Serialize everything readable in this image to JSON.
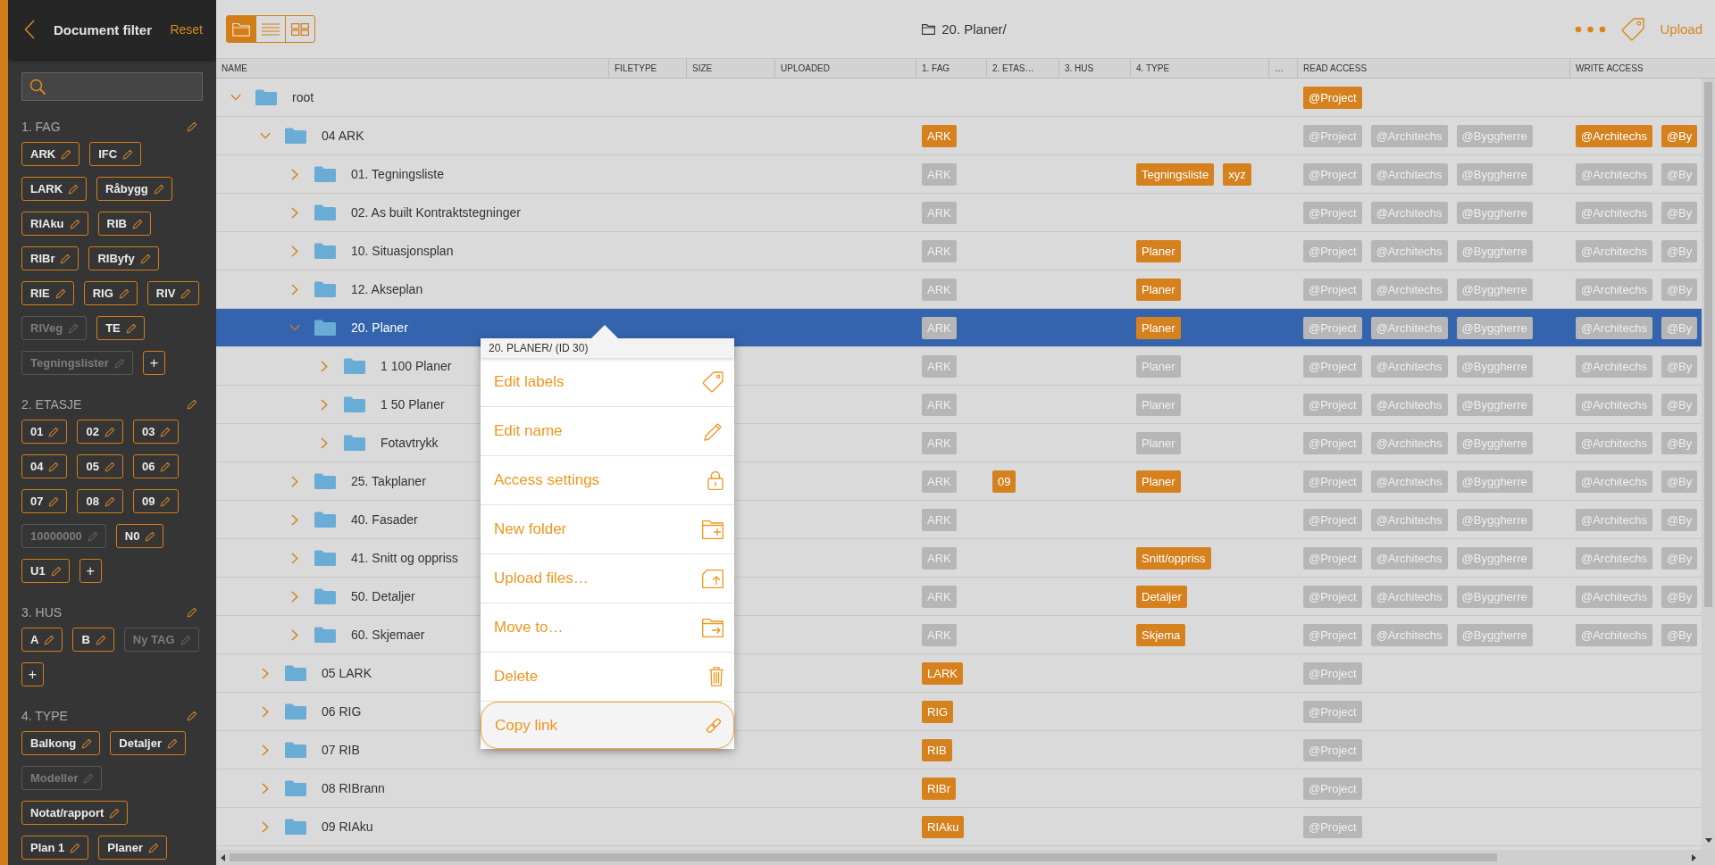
{
  "sidebar": {
    "title": "Document filter",
    "reset": "Reset",
    "sections": [
      {
        "title": "1. FAG",
        "tags": [
          {
            "label": "ARK",
            "disabled": false
          },
          {
            "label": "IFC",
            "disabled": false
          },
          {
            "label": "LARK",
            "disabled": false
          },
          {
            "label": "Råbygg",
            "disabled": false
          },
          {
            "label": "RIAku",
            "disabled": false
          },
          {
            "label": "RIB",
            "disabled": false
          },
          {
            "label": "RIBr",
            "disabled": false
          },
          {
            "label": "RIByfy",
            "disabled": false
          },
          {
            "label": "RIE",
            "disabled": false
          },
          {
            "label": "RIG",
            "disabled": false
          },
          {
            "label": "RIV",
            "disabled": false
          },
          {
            "label": "RIVeg",
            "disabled": true
          },
          {
            "label": "TE",
            "disabled": false
          },
          {
            "label": "Tegningslister",
            "disabled": true
          }
        ],
        "add": "+"
      },
      {
        "title": "2. ETASJE",
        "tags": [
          {
            "label": "01",
            "disabled": false
          },
          {
            "label": "02",
            "disabled": false
          },
          {
            "label": "03",
            "disabled": false
          },
          {
            "label": "04",
            "disabled": false
          },
          {
            "label": "05",
            "disabled": false
          },
          {
            "label": "06",
            "disabled": false
          },
          {
            "label": "07",
            "disabled": false
          },
          {
            "label": "08",
            "disabled": false
          },
          {
            "label": "09",
            "disabled": false
          },
          {
            "label": "10000000",
            "disabled": true
          },
          {
            "label": "N0",
            "disabled": false
          },
          {
            "label": "U1",
            "disabled": false
          }
        ],
        "add": "+"
      },
      {
        "title": "3. HUS",
        "tags": [
          {
            "label": "A",
            "disabled": false
          },
          {
            "label": "B",
            "disabled": false
          },
          {
            "label": "Ny TAG",
            "disabled": true
          }
        ],
        "add": "+"
      },
      {
        "title": "4. TYPE",
        "tags": [
          {
            "label": "Balkong",
            "disabled": false
          },
          {
            "label": "Detaljer",
            "disabled": false
          },
          {
            "label": "Modeller",
            "disabled": true
          },
          {
            "label": "Notat/rapport",
            "disabled": false
          },
          {
            "label": "Plan 1",
            "disabled": false
          },
          {
            "label": "Planer",
            "disabled": false
          }
        ]
      }
    ]
  },
  "toolbar": {
    "views": [
      {
        "kind": "folders",
        "selected": true
      },
      {
        "kind": "list",
        "selected": false
      },
      {
        "kind": "grid",
        "selected": false
      }
    ],
    "path": "20. Planer/",
    "upload": "Upload"
  },
  "table": {
    "columns": [
      "NAME",
      "FILETYPE",
      "SIZE",
      "UPLOADED",
      "1. FAG",
      "2. ETAS…",
      "3. HUS",
      "4. TYPE",
      "…",
      "READ ACCESS",
      "WRITE ACCESS"
    ],
    "rows": [
      {
        "name": "root",
        "expanded": true,
        "selected": false,
        "read_access": [
          {
            "label": "@Project",
            "inherited": false
          }
        ],
        "children": [
          {
            "name": "04 ARK",
            "expanded": true,
            "selected": false,
            "fag": [
              {
                "label": "ARK",
                "inherited": false
              }
            ],
            "read_access": [
              {
                "label": "@Project",
                "inherited": true
              },
              {
                "label": "@Architechs",
                "inherited": true
              },
              {
                "label": "@Byggherre",
                "inherited": true
              }
            ],
            "write_access": [
              {
                "label": "@Architechs",
                "inherited": false
              },
              {
                "label": "@By",
                "inherited": false
              }
            ],
            "children": [
              {
                "name": "01. Tegningsliste",
                "expanded": false,
                "selected": false,
                "fag": [
                  {
                    "label": "ARK",
                    "inherited": true
                  }
                ],
                "type": [
                  {
                    "label": "Tegningsliste",
                    "inherited": false
                  },
                  {
                    "label": "xyz",
                    "inherited": false
                  }
                ],
                "read_access": [
                  {
                    "label": "@Project",
                    "inherited": true
                  },
                  {
                    "label": "@Architechs",
                    "inherited": true
                  },
                  {
                    "label": "@Byggherre",
                    "inherited": true
                  }
                ],
                "write_access": [
                  {
                    "label": "@Architechs",
                    "inherited": true
                  },
                  {
                    "label": "@By",
                    "inherited": true
                  }
                ]
              },
              {
                "name": "02. As built Kontraktstegninger",
                "expanded": false,
                "selected": false,
                "fag": [
                  {
                    "label": "ARK",
                    "inherited": true
                  }
                ],
                "read_access": [
                  {
                    "label": "@Project",
                    "inherited": true
                  },
                  {
                    "label": "@Architechs",
                    "inherited": true
                  },
                  {
                    "label": "@Byggherre",
                    "inherited": true
                  }
                ],
                "write_access": [
                  {
                    "label": "@Architechs",
                    "inherited": true
                  },
                  {
                    "label": "@By",
                    "inherited": true
                  }
                ]
              },
              {
                "name": "10. Situasjonsplan",
                "expanded": false,
                "selected": false,
                "fag": [
                  {
                    "label": "ARK",
                    "inherited": true
                  }
                ],
                "type": [
                  {
                    "label": "Planer",
                    "inherited": false
                  }
                ],
                "read_access": [
                  {
                    "label": "@Project",
                    "inherited": true
                  },
                  {
                    "label": "@Architechs",
                    "inherited": true
                  },
                  {
                    "label": "@Byggherre",
                    "inherited": true
                  }
                ],
                "write_access": [
                  {
                    "label": "@Architechs",
                    "inherited": true
                  },
                  {
                    "label": "@By",
                    "inherited": true
                  }
                ]
              },
              {
                "name": "12. Akseplan",
                "expanded": false,
                "selected": false,
                "fag": [
                  {
                    "label": "ARK",
                    "inherited": true
                  }
                ],
                "type": [
                  {
                    "label": "Planer",
                    "inherited": false
                  }
                ],
                "read_access": [
                  {
                    "label": "@Project",
                    "inherited": true
                  },
                  {
                    "label": "@Architechs",
                    "inherited": true
                  },
                  {
                    "label": "@Byggherre",
                    "inherited": true
                  }
                ],
                "write_access": [
                  {
                    "label": "@Architechs",
                    "inherited": true
                  },
                  {
                    "label": "@By",
                    "inherited": true
                  }
                ]
              },
              {
                "name": "20. Planer",
                "expanded": true,
                "selected": true,
                "fag": [
                  {
                    "label": "ARK",
                    "inherited": true
                  }
                ],
                "type": [
                  {
                    "label": "Planer",
                    "inherited": false
                  }
                ],
                "read_access": [
                  {
                    "label": "@Project",
                    "inherited": true
                  },
                  {
                    "label": "@Architechs",
                    "inherited": true
                  },
                  {
                    "label": "@Byggherre",
                    "inherited": true
                  }
                ],
                "write_access": [
                  {
                    "label": "@Architechs",
                    "inherited": true
                  },
                  {
                    "label": "@By",
                    "inherited": true
                  }
                ],
                "children": [
                  {
                    "name": "1 100 Planer",
                    "expanded": false,
                    "selected": false,
                    "fag": [
                      {
                        "label": "ARK",
                        "inherited": true
                      }
                    ],
                    "type": [
                      {
                        "label": "Planer",
                        "inherited": true
                      }
                    ],
                    "read_access": [
                      {
                        "label": "@Project",
                        "inherited": true
                      },
                      {
                        "label": "@Architechs",
                        "inherited": true
                      },
                      {
                        "label": "@Byggherre",
                        "inherited": true
                      }
                    ],
                    "write_access": [
                      {
                        "label": "@Architechs",
                        "inherited": true
                      },
                      {
                        "label": "@By",
                        "inherited": true
                      }
                    ]
                  },
                  {
                    "name": "1 50 Planer",
                    "expanded": false,
                    "selected": false,
                    "fag": [
                      {
                        "label": "ARK",
                        "inherited": true
                      }
                    ],
                    "type": [
                      {
                        "label": "Planer",
                        "inherited": true
                      }
                    ],
                    "read_access": [
                      {
                        "label": "@Project",
                        "inherited": true
                      },
                      {
                        "label": "@Architechs",
                        "inherited": true
                      },
                      {
                        "label": "@Byggherre",
                        "inherited": true
                      }
                    ],
                    "write_access": [
                      {
                        "label": "@Architechs",
                        "inherited": true
                      },
                      {
                        "label": "@By",
                        "inherited": true
                      }
                    ]
                  },
                  {
                    "name": "Fotavtrykk",
                    "expanded": false,
                    "selected": false,
                    "fag": [
                      {
                        "label": "ARK",
                        "inherited": true
                      }
                    ],
                    "type": [
                      {
                        "label": "Planer",
                        "inherited": true
                      }
                    ],
                    "read_access": [
                      {
                        "label": "@Project",
                        "inherited": true
                      },
                      {
                        "label": "@Architechs",
                        "inherited": true
                      },
                      {
                        "label": "@Byggherre",
                        "inherited": true
                      }
                    ],
                    "write_access": [
                      {
                        "label": "@Architechs",
                        "inherited": true
                      },
                      {
                        "label": "@By",
                        "inherited": true
                      }
                    ]
                  }
                ]
              },
              {
                "name": "25. Takplaner",
                "expanded": false,
                "selected": false,
                "fag": [
                  {
                    "label": "ARK",
                    "inherited": true
                  }
                ],
                "etasje": [
                  {
                    "label": "09",
                    "inherited": false
                  }
                ],
                "type": [
                  {
                    "label": "Planer",
                    "inherited": false
                  }
                ],
                "read_access": [
                  {
                    "label": "@Project",
                    "inherited": true
                  },
                  {
                    "label": "@Architechs",
                    "inherited": true
                  },
                  {
                    "label": "@Byggherre",
                    "inherited": true
                  }
                ],
                "write_access": [
                  {
                    "label": "@Architechs",
                    "inherited": true
                  },
                  {
                    "label": "@By",
                    "inherited": true
                  }
                ]
              },
              {
                "name": "40. Fasader",
                "expanded": false,
                "selected": false,
                "fag": [
                  {
                    "label": "ARK",
                    "inherited": true
                  }
                ],
                "read_access": [
                  {
                    "label": "@Project",
                    "inherited": true
                  },
                  {
                    "label": "@Architechs",
                    "inherited": true
                  },
                  {
                    "label": "@Byggherre",
                    "inherited": true
                  }
                ],
                "write_access": [
                  {
                    "label": "@Architechs",
                    "inherited": true
                  },
                  {
                    "label": "@By",
                    "inherited": true
                  }
                ]
              },
              {
                "name": "41. Snitt og oppriss",
                "expanded": false,
                "selected": false,
                "fag": [
                  {
                    "label": "ARK",
                    "inherited": true
                  }
                ],
                "type": [
                  {
                    "label": "Snitt/oppriss",
                    "inherited": false
                  }
                ],
                "read_access": [
                  {
                    "label": "@Project",
                    "inherited": true
                  },
                  {
                    "label": "@Architechs",
                    "inherited": true
                  },
                  {
                    "label": "@Byggherre",
                    "inherited": true
                  }
                ],
                "write_access": [
                  {
                    "label": "@Architechs",
                    "inherited": true
                  },
                  {
                    "label": "@By",
                    "inherited": true
                  }
                ]
              },
              {
                "name": "50. Detaljer",
                "expanded": false,
                "selected": false,
                "fag": [
                  {
                    "label": "ARK",
                    "inherited": true
                  }
                ],
                "type": [
                  {
                    "label": "Detaljer",
                    "inherited": false
                  }
                ],
                "read_access": [
                  {
                    "label": "@Project",
                    "inherited": true
                  },
                  {
                    "label": "@Architechs",
                    "inherited": true
                  },
                  {
                    "label": "@Byggherre",
                    "inherited": true
                  }
                ],
                "write_access": [
                  {
                    "label": "@Architechs",
                    "inherited": true
                  },
                  {
                    "label": "@By",
                    "inherited": true
                  }
                ]
              },
              {
                "name": "60. Skjemaer",
                "expanded": false,
                "selected": false,
                "fag": [
                  {
                    "label": "ARK",
                    "inherited": true
                  }
                ],
                "type": [
                  {
                    "label": "Skjema",
                    "inherited": false
                  }
                ],
                "read_access": [
                  {
                    "label": "@Project",
                    "inherited": true
                  },
                  {
                    "label": "@Architechs",
                    "inherited": true
                  },
                  {
                    "label": "@Byggherre",
                    "inherited": true
                  }
                ],
                "write_access": [
                  {
                    "label": "@Architechs",
                    "inherited": true
                  },
                  {
                    "label": "@By",
                    "inherited": true
                  }
                ]
              }
            ]
          },
          {
            "name": "05 LARK",
            "expanded": false,
            "selected": false,
            "fag": [
              {
                "label": "LARK",
                "inherited": false
              }
            ],
            "read_access": [
              {
                "label": "@Project",
                "inherited": true
              }
            ]
          },
          {
            "name": "06 RIG",
            "expanded": false,
            "selected": false,
            "fag": [
              {
                "label": "RIG",
                "inherited": false
              }
            ],
            "read_access": [
              {
                "label": "@Project",
                "inherited": true
              }
            ]
          },
          {
            "name": "07 RIB",
            "expanded": false,
            "selected": false,
            "fag": [
              {
                "label": "RIB",
                "inherited": false
              }
            ],
            "read_access": [
              {
                "label": "@Project",
                "inherited": true
              }
            ]
          },
          {
            "name": "08 RIBrann",
            "expanded": false,
            "selected": false,
            "fag": [
              {
                "label": "RIBr",
                "inherited": false
              }
            ],
            "read_access": [
              {
                "label": "@Project",
                "inherited": true
              }
            ]
          },
          {
            "name": "09 RIAku",
            "expanded": false,
            "selected": false,
            "fag": [
              {
                "label": "RIAku",
                "inherited": false
              }
            ],
            "read_access": [
              {
                "label": "@Project",
                "inherited": true
              }
            ]
          }
        ]
      }
    ]
  },
  "context_menu": {
    "title": "20. PLANER/ (ID 30)",
    "items": [
      {
        "label": "Edit labels",
        "highlighted": false
      },
      {
        "label": "Edit name",
        "highlighted": false
      },
      {
        "label": "Access settings",
        "highlighted": false
      },
      {
        "label": "New folder",
        "highlighted": false
      },
      {
        "label": "Upload files…",
        "highlighted": false
      },
      {
        "label": "Move to…",
        "highlighted": false
      },
      {
        "label": "Delete",
        "highlighted": false
      },
      {
        "label": "Copy link",
        "highlighted": true
      }
    ]
  }
}
